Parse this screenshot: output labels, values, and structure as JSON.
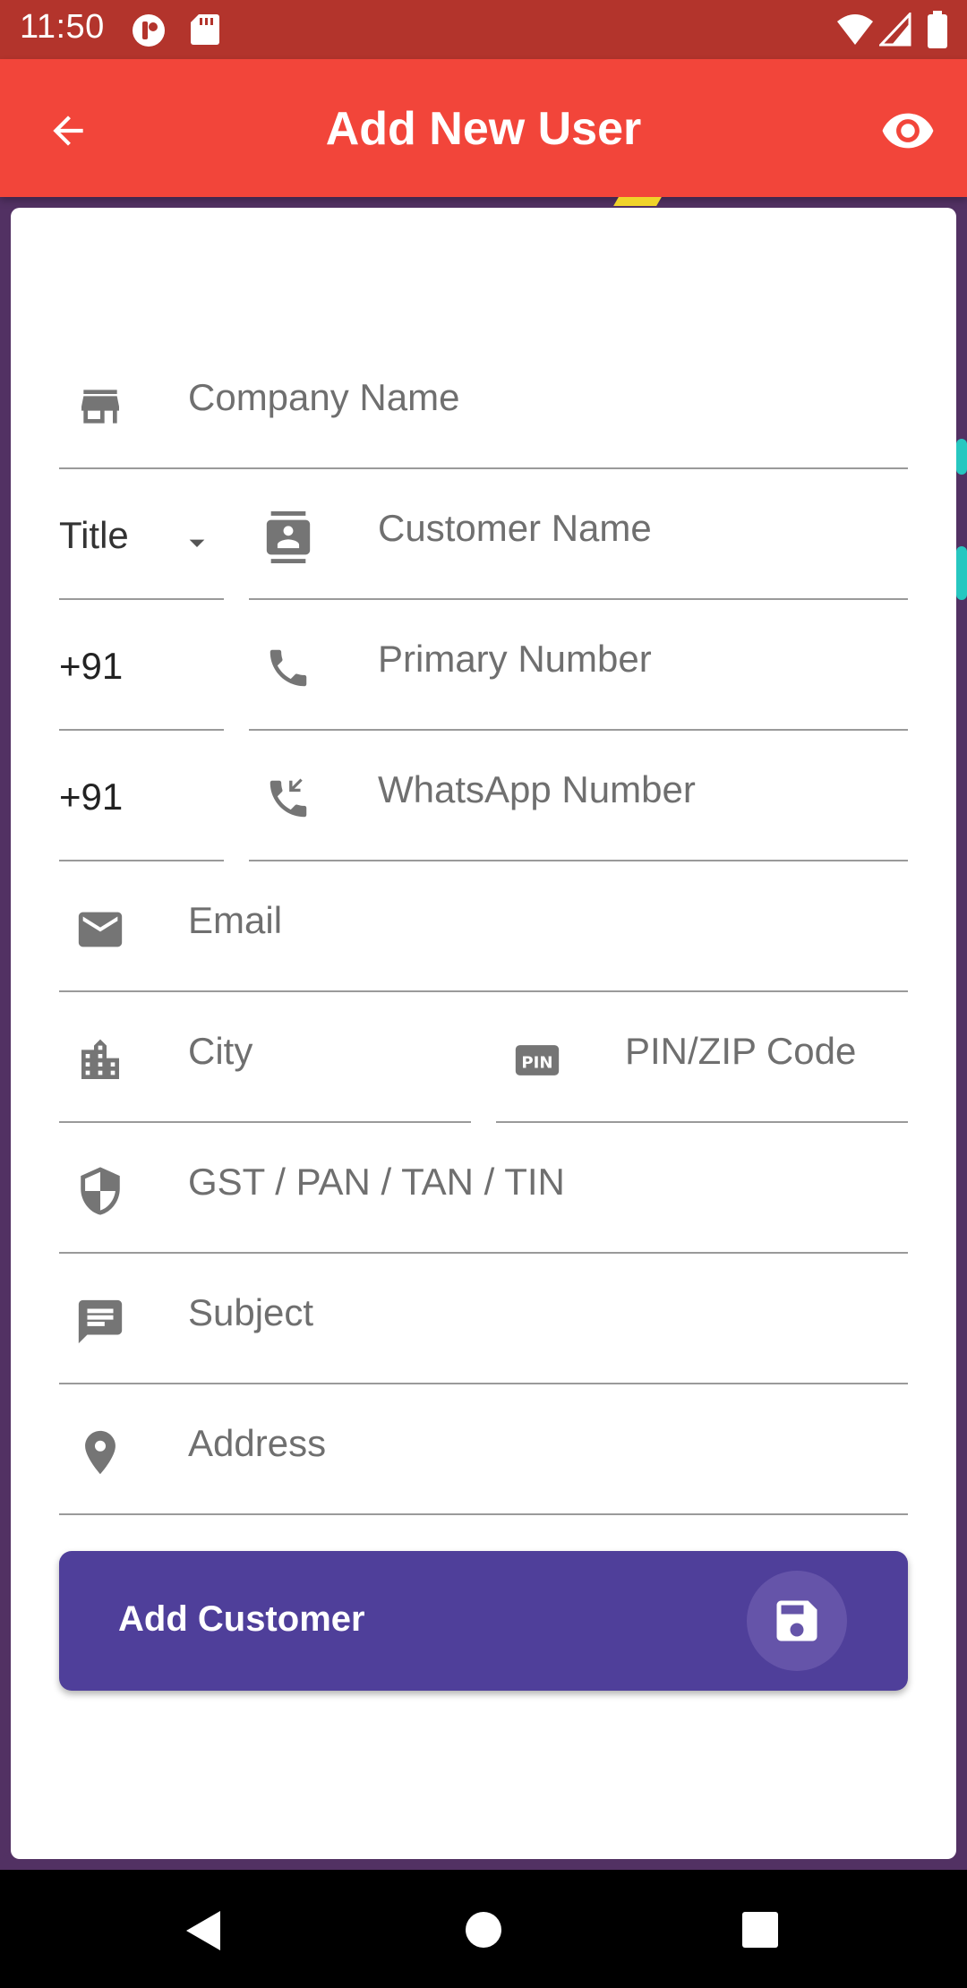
{
  "status_bar": {
    "time": "11:50",
    "icons": [
      "notification-app-icon",
      "sd-card-icon",
      "wifi-icon",
      "signal-icon",
      "battery-icon"
    ]
  },
  "app_bar": {
    "title": "Add New User",
    "back_icon": "arrow-back-icon",
    "action_icon": "eye-icon"
  },
  "form": {
    "company_name_placeholder": "Company Name",
    "title_dropdown_value": "Title",
    "customer_name_placeholder": "Customer Name",
    "primary_code": "+91",
    "primary_number_placeholder": "Primary Number",
    "whatsapp_code": "+91",
    "whatsapp_number_placeholder": "WhatsApp Number",
    "email_placeholder": "Email",
    "city_placeholder": "City",
    "pin_placeholder": "PIN/ZIP Code",
    "tax_placeholder": "GST / PAN / TAN / TIN",
    "subject_placeholder": "Subject",
    "address_placeholder": "Address"
  },
  "submit": {
    "label": "Add Customer",
    "icon": "save-icon"
  },
  "colors": {
    "status_bar": "#b3342c",
    "app_bar": "#f2453a",
    "background": "#523163",
    "button": "#4f3f9a"
  }
}
